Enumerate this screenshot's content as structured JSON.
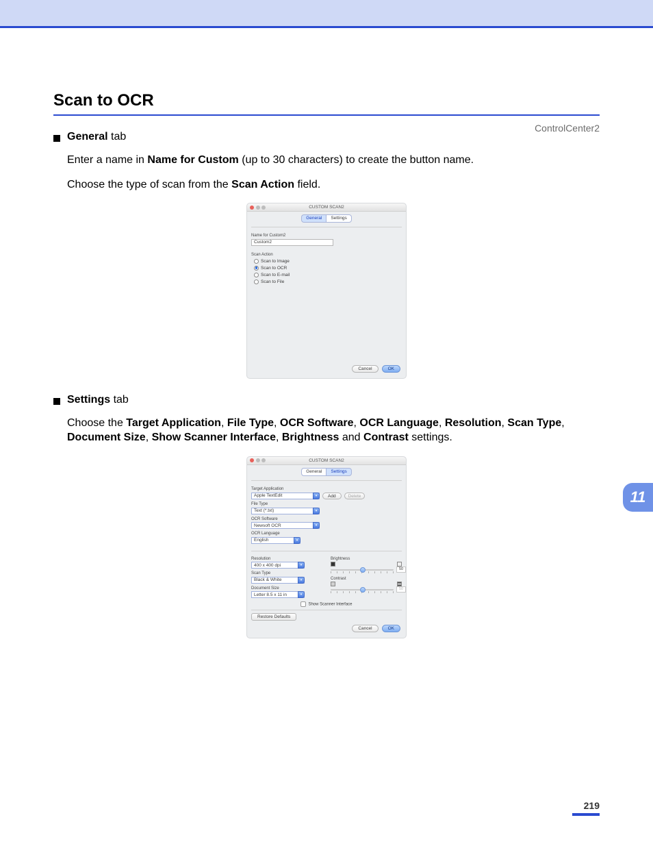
{
  "header": {
    "product": "ControlCenter2"
  },
  "section": {
    "title": "Scan to OCR"
  },
  "general_tab": {
    "bullet_label_prefix": "General",
    "bullet_label_suffix": " tab",
    "p1_a": "Enter a name in ",
    "p1_b": "Name for Custom",
    "p1_c": " (up to 30 characters) to create the button name.",
    "p2_a": "Choose the type of scan from the ",
    "p2_b": "Scan Action",
    "p2_c": " field."
  },
  "dialog1": {
    "title": "CUSTOM SCAN2",
    "tabs": {
      "general": "General",
      "settings": "Settings"
    },
    "name_label": "Name for Custom2",
    "name_value": "Custom2",
    "scan_action_label": "Scan Action",
    "opts": {
      "image": "Scan to Image",
      "ocr": "Scan to OCR",
      "email": "Scan to E-mail",
      "file": "Scan to File"
    },
    "cancel": "Cancel",
    "ok": "OK"
  },
  "settings_tab": {
    "bullet_label_prefix": "Settings",
    "bullet_label_suffix": " tab",
    "p_a": "Choose the ",
    "p_b1": "Target Application",
    "sep": ", ",
    "p_b2": "File Type",
    "p_b3": "OCR Software",
    "p_b4": "OCR Language",
    "p_b5": "Resolution",
    "p_b6": "Scan Type",
    "p_b7": "Document Size",
    "p_b8": "Show Scanner Interface",
    "p_b9": "Brightness",
    "and": " and ",
    "p_b10": "Contrast",
    "p_end": " settings."
  },
  "dialog2": {
    "title": "CUSTOM SCAN2",
    "tabs": {
      "general": "General",
      "settings": "Settings"
    },
    "target_label": "Target Application",
    "target_value": "Apple TextEdit",
    "add": "Add",
    "delete": "Delete",
    "filetype_label": "File Type",
    "filetype_value": "Text (*.txt)",
    "ocrsw_label": "OCR Software",
    "ocrsw_value": "Newsoft OCR",
    "ocrlang_label": "OCR Language",
    "ocrlang_value": "English",
    "res_label": "Resolution",
    "res_value": "400 x 400 dpi",
    "scantype_label": "Scan Type",
    "scantype_value": "Black & White",
    "docsize_label": "Document Size",
    "docsize_value": "Letter  8.5 x 11 in",
    "brightness_label": "Brightness",
    "brightness_value": "50",
    "contrast_label": "Contrast",
    "contrast_value": "50",
    "show_scanner": "Show Scanner Interface",
    "restore": "Restore Defaults",
    "cancel": "Cancel",
    "ok": "OK"
  },
  "side_tab": "11",
  "page_number": "219"
}
